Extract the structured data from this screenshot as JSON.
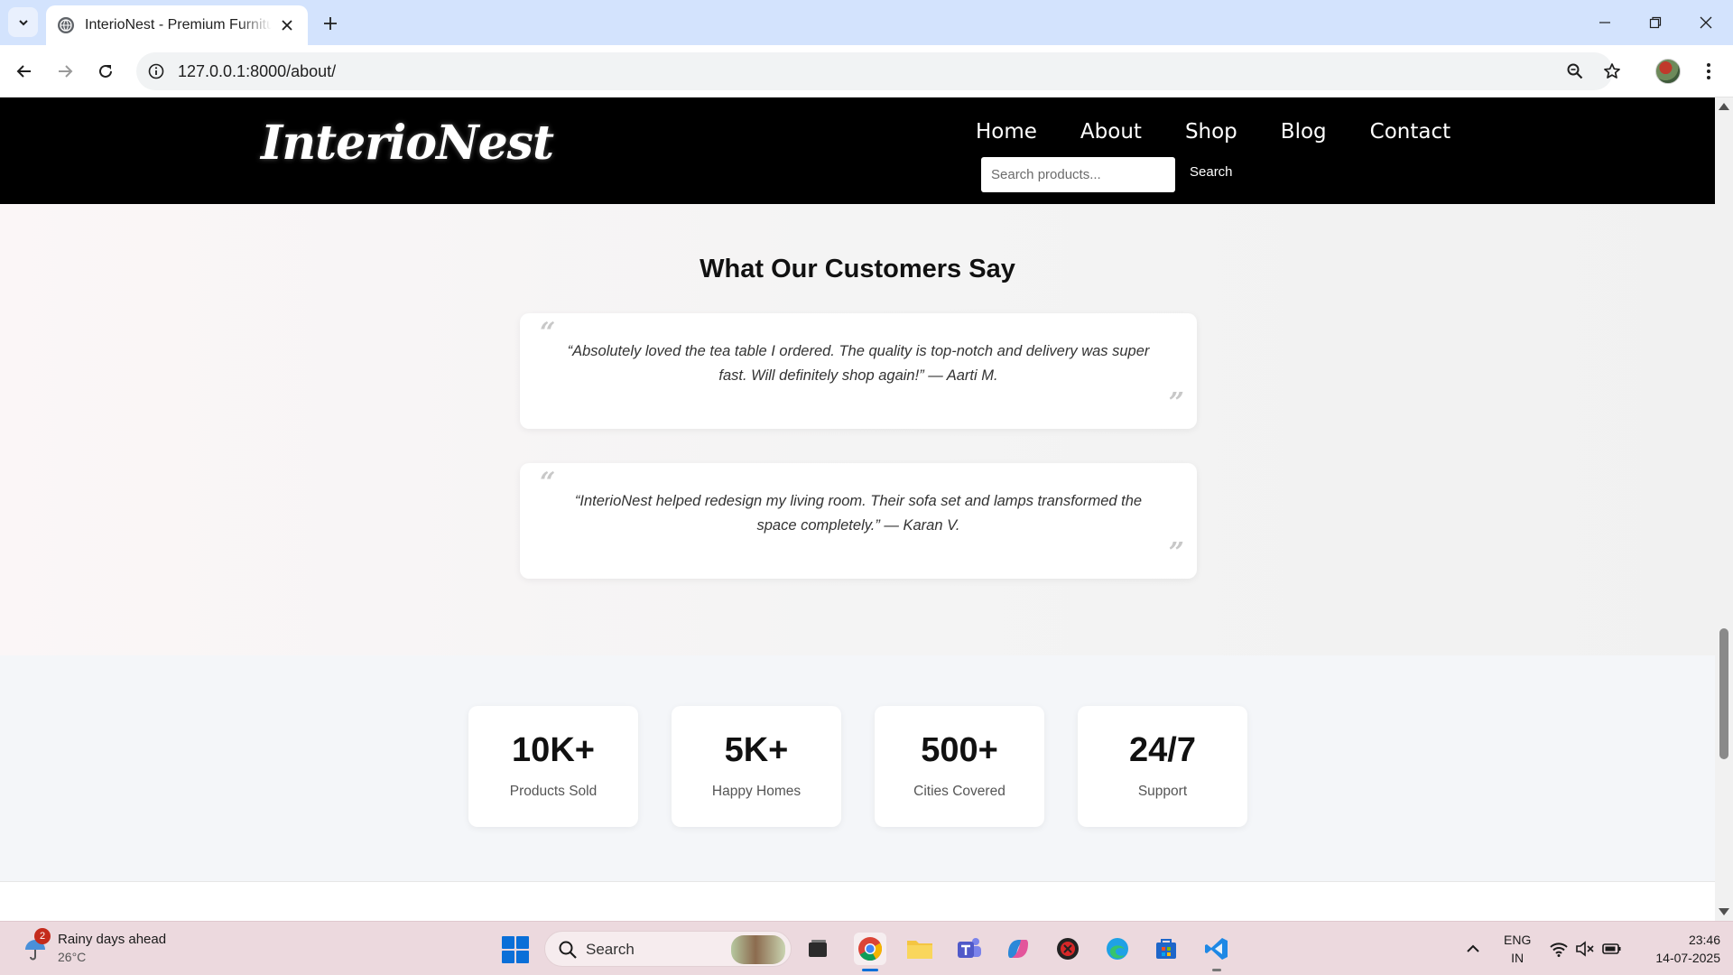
{
  "browser": {
    "tab_title": "InterioNest - Premium Furniture",
    "url": "127.0.0.1:8000/about/"
  },
  "site": {
    "logo": "InterioNest",
    "nav": [
      "Home",
      "About",
      "Shop",
      "Blog",
      "Contact"
    ],
    "search_placeholder": "Search products...",
    "search_button": "Search"
  },
  "testimonials": {
    "title": "What Our Customers Say",
    "quotes": [
      "“Absolutely loved the tea table I ordered. The quality is top-notch and delivery was super fast. Will definitely shop again!” — Aarti M.",
      "“InterioNest helped redesign my living room. Their sofa set and lamps transformed the space completely.” — Karan V."
    ],
    "open_mark": "“",
    "close_mark": "”"
  },
  "stats": [
    {
      "value": "10K+",
      "label": "Products Sold"
    },
    {
      "value": "5K+",
      "label": "Happy Homes"
    },
    {
      "value": "500+",
      "label": "Cities Covered"
    },
    {
      "value": "24/7",
      "label": "Support"
    }
  ],
  "taskbar": {
    "weather_title": "Rainy days ahead",
    "weather_temp": "26°C",
    "weather_badge": "2",
    "search_text": "Search",
    "lang_line1": "ENG",
    "lang_line2": "IN",
    "time": "23:46",
    "date": "14-07-2025"
  },
  "colors": {
    "header_bg": "#000000",
    "tabstrip_bg": "#d3e3fd",
    "taskbar_bg": "#ecd9de",
    "accent_blue": "#0a6fd8"
  },
  "icons": {
    "tab_list": "chevron-down-icon",
    "favicon": "globe-icon",
    "tab_close": "close-icon",
    "new_tab": "plus-icon",
    "back": "arrow-left-icon",
    "forward": "arrow-right-icon",
    "reload": "reload-icon",
    "site_info": "info-icon",
    "zoom": "zoom-icon",
    "bookmark": "star-icon",
    "menu": "kebab-menu-icon"
  }
}
